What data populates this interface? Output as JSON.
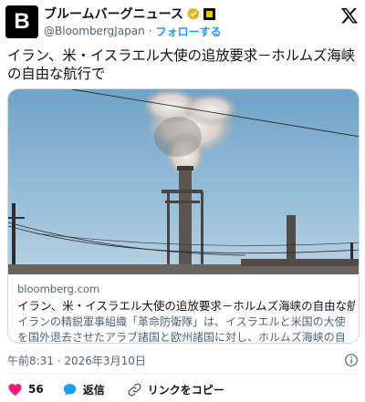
{
  "account": {
    "avatar_letter": "B",
    "name": "ブルームバーグニュース",
    "handle": "@BloombergJapan",
    "separator": "·",
    "follow_label": "フォローする"
  },
  "tweet": {
    "text": "イラン、米・イスラエル大使の追放要求－ホルムズ海峡の自由な航行で"
  },
  "link_card": {
    "domain": "bloomberg.com",
    "title": "イラン、米・イスラエル大使の追放要求－ホルムズ海峡の自由な航行で",
    "description": "イランの精鋭軍事組織「革命防衛隊」は、イスラエルと米国の大使を国外退去させたアラブ諸国と欧州諸国に対し、ホルムズ海峡の自由な航..."
  },
  "meta": {
    "timestamp": "午前8:31 · 2026年3月10日"
  },
  "actions": {
    "like_count": "56",
    "reply_label": "返信",
    "copy_link_label": "リンクをコピー"
  },
  "colors": {
    "accent": "#1d9bf0",
    "like": "#f91880",
    "secondary_text": "#536471"
  }
}
